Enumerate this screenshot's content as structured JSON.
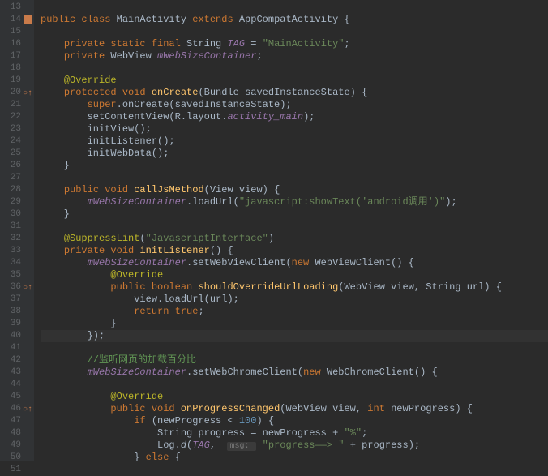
{
  "gutter": {
    "start": 13,
    "end": 51,
    "markers": {
      "14": "file",
      "20": "override",
      "36": "override",
      "46": "override"
    }
  },
  "selected_line": 40,
  "code": {
    "l13": "",
    "l14": [
      {
        "t": "public class ",
        "c": "kw"
      },
      {
        "t": "MainActivity ",
        "c": "type"
      },
      {
        "t": "extends ",
        "c": "kw"
      },
      {
        "t": "AppCompatActivity {",
        "c": "type"
      }
    ],
    "l15": "",
    "l16": [
      {
        "t": "    "
      },
      {
        "t": "private static final ",
        "c": "kw"
      },
      {
        "t": "String ",
        "c": "type"
      },
      {
        "t": "TAG",
        "c": "const"
      },
      {
        "t": " = "
      },
      {
        "t": "\"MainActivity\"",
        "c": "str"
      },
      {
        "t": ";"
      }
    ],
    "l17": [
      {
        "t": "    "
      },
      {
        "t": "private ",
        "c": "kw"
      },
      {
        "t": "WebView ",
        "c": "type"
      },
      {
        "t": "mWebSizeContainer",
        "c": "field"
      },
      {
        "t": ";"
      }
    ],
    "l18": "",
    "l19": [
      {
        "t": "    "
      },
      {
        "t": "@Override",
        "c": "ann"
      }
    ],
    "l20": [
      {
        "t": "    "
      },
      {
        "t": "protected void ",
        "c": "kw"
      },
      {
        "t": "onCreate",
        "c": "fn"
      },
      {
        "t": "(Bundle savedInstanceState) {"
      }
    ],
    "l21": [
      {
        "t": "        "
      },
      {
        "t": "super",
        "c": "kw"
      },
      {
        "t": ".onCreate(savedInstanceState);"
      }
    ],
    "l22": [
      {
        "t": "        setContentView(R.layout."
      },
      {
        "t": "activity_main",
        "c": "field"
      },
      {
        "t": ");"
      }
    ],
    "l23": [
      {
        "t": "        initView();"
      }
    ],
    "l24": [
      {
        "t": "        initListener();"
      }
    ],
    "l25": [
      {
        "t": "        initWebData();"
      }
    ],
    "l26": [
      {
        "t": "    }"
      }
    ],
    "l27": "",
    "l28": [
      {
        "t": "    "
      },
      {
        "t": "public void ",
        "c": "kw"
      },
      {
        "t": "callJsMethod",
        "c": "fn"
      },
      {
        "t": "(View view) {"
      }
    ],
    "l29": [
      {
        "t": "        "
      },
      {
        "t": "mWebSizeContainer",
        "c": "field"
      },
      {
        "t": ".loadUrl("
      },
      {
        "t": "\"javascript:showText('android调用')\"",
        "c": "str"
      },
      {
        "t": ");"
      }
    ],
    "l30": [
      {
        "t": "    }"
      }
    ],
    "l31": "",
    "l32": [
      {
        "t": "    "
      },
      {
        "t": "@SuppressLint",
        "c": "ann"
      },
      {
        "t": "("
      },
      {
        "t": "\"JavascriptInterface\"",
        "c": "str"
      },
      {
        "t": ")"
      }
    ],
    "l33": [
      {
        "t": "    "
      },
      {
        "t": "private void ",
        "c": "kw"
      },
      {
        "t": "initListener",
        "c": "fn"
      },
      {
        "t": "() {"
      }
    ],
    "l34": [
      {
        "t": "        "
      },
      {
        "t": "mWebSizeContainer",
        "c": "field"
      },
      {
        "t": ".setWebViewClient("
      },
      {
        "t": "new ",
        "c": "kw"
      },
      {
        "t": "WebViewClient() {"
      }
    ],
    "l35": [
      {
        "t": "            "
      },
      {
        "t": "@Override",
        "c": "ann"
      }
    ],
    "l36": [
      {
        "t": "            "
      },
      {
        "t": "public boolean ",
        "c": "kw"
      },
      {
        "t": "shouldOverrideUrlLoading",
        "c": "fn"
      },
      {
        "t": "(WebView view, String url) {"
      }
    ],
    "l37": [
      {
        "t": "                view.loadUrl(url);"
      }
    ],
    "l38": [
      {
        "t": "                "
      },
      {
        "t": "return true",
        "c": "kw"
      },
      {
        "t": ";"
      }
    ],
    "l39": [
      {
        "t": "            }"
      }
    ],
    "l40": [
      {
        "t": "        });"
      }
    ],
    "l41": "",
    "l42": [
      {
        "t": "        "
      },
      {
        "t": "//监听网页的加载百分比",
        "c": "cmt"
      }
    ],
    "l43": [
      {
        "t": "        "
      },
      {
        "t": "mWebSizeContainer",
        "c": "field"
      },
      {
        "t": ".setWebChromeClient("
      },
      {
        "t": "new ",
        "c": "kw"
      },
      {
        "t": "WebChromeClient() {"
      }
    ],
    "l44": "",
    "l45": [
      {
        "t": "            "
      },
      {
        "t": "@Override",
        "c": "ann"
      }
    ],
    "l46": [
      {
        "t": "            "
      },
      {
        "t": "public void ",
        "c": "kw"
      },
      {
        "t": "onProgressChanged",
        "c": "fn"
      },
      {
        "t": "(WebView view, "
      },
      {
        "t": "int ",
        "c": "kw"
      },
      {
        "t": "newProgress) {"
      }
    ],
    "l47": [
      {
        "t": "                "
      },
      {
        "t": "if ",
        "c": "kw"
      },
      {
        "t": "(newProgress < "
      },
      {
        "t": "100",
        "c": "num"
      },
      {
        "t": ") {"
      }
    ],
    "l48": [
      {
        "t": "                    String "
      },
      {
        "t": "progress",
        "c": "param"
      },
      {
        "t": " = newProgress + "
      },
      {
        "t": "\"%\"",
        "c": "str"
      },
      {
        "t": ";"
      }
    ],
    "l49": [
      {
        "t": "                    Log."
      },
      {
        "t": "d",
        "c": "static-call"
      },
      {
        "t": "("
      },
      {
        "t": "TAG",
        "c": "const"
      },
      {
        "t": ",  "
      },
      {
        "t": "msg: ",
        "c": "hint"
      },
      {
        "t": " "
      },
      {
        "t": "\"progress——> \"",
        "c": "str"
      },
      {
        "t": " + progress);"
      }
    ],
    "l50": [
      {
        "t": "                } "
      },
      {
        "t": "else ",
        "c": "kw"
      },
      {
        "t": "{"
      }
    ],
    "l51": ""
  }
}
